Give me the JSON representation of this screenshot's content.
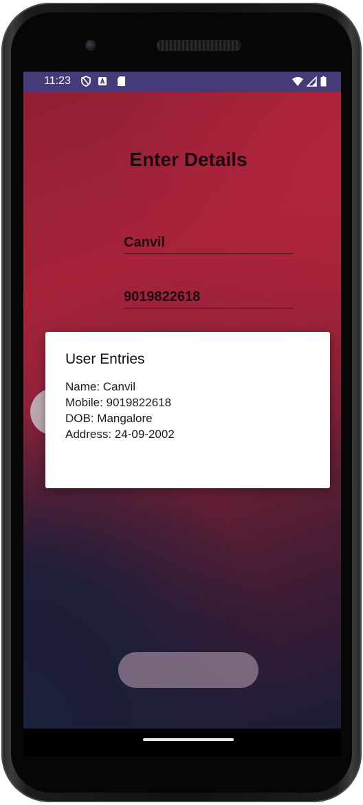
{
  "status_bar": {
    "time": "11:23",
    "left_icons": [
      "shield-icon",
      "notification-a-icon",
      "sd-card-icon"
    ],
    "right_icons": [
      "wifi-icon",
      "signal-icon",
      "battery-icon"
    ],
    "color": "#463a78"
  },
  "form": {
    "title": "Enter Details",
    "name_value": "Canvil",
    "mobile_value": "9019822618"
  },
  "dialog": {
    "title": "User Entries",
    "lines": [
      "Name: Canvil",
      "Mobile: 9019822618",
      "DOB: Mangalore",
      "Address: 24-09-2002"
    ]
  },
  "colors": {
    "gradient_red": "#a7233a",
    "gradient_navy": "#1a1f3a",
    "dialog_background": "#ffffff"
  }
}
